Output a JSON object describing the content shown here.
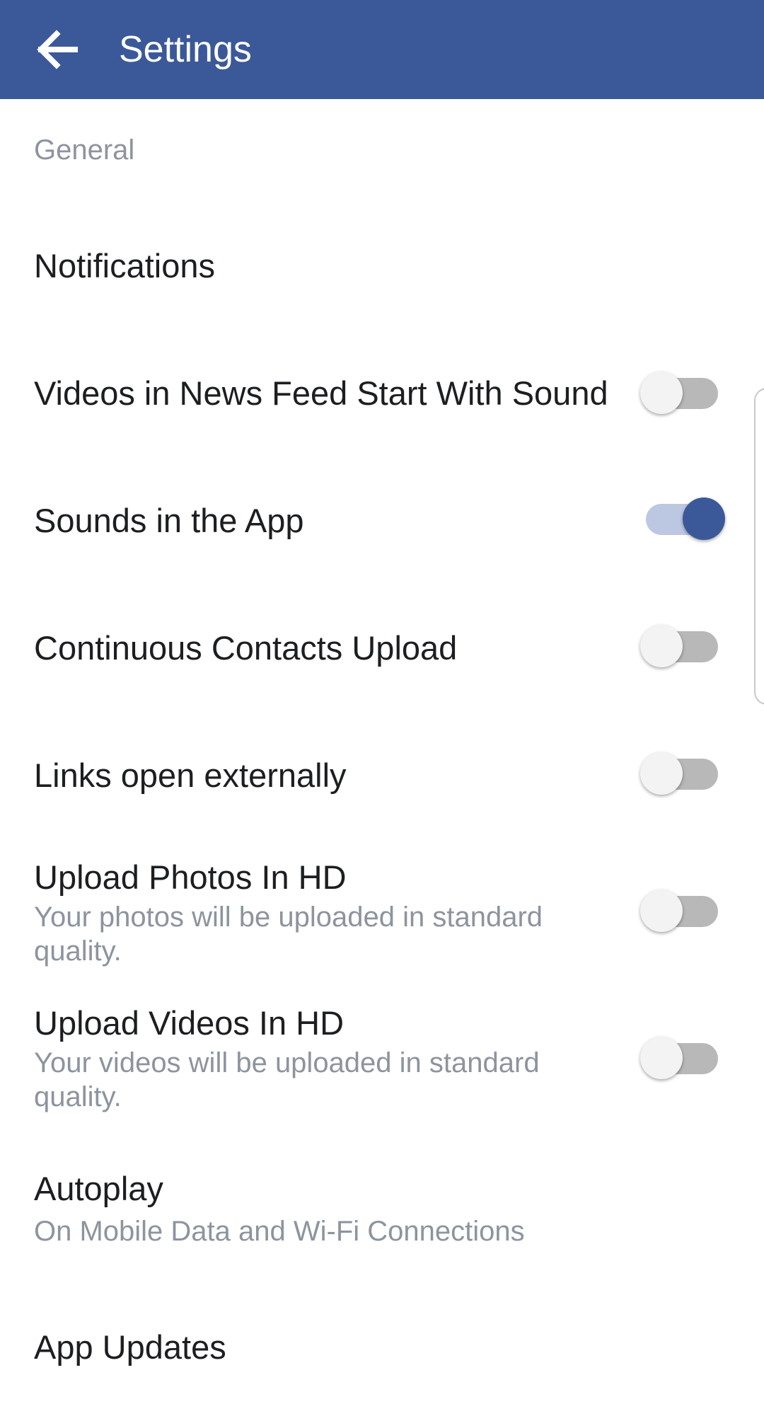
{
  "app_bar": {
    "title": "Settings",
    "back_icon": "arrow-back-icon",
    "background": "#3b5998"
  },
  "section_header": "General",
  "items": [
    {
      "label": "Notifications",
      "subtitle": "",
      "toggle": null
    },
    {
      "label": "Videos in News Feed Start With Sound",
      "subtitle": "",
      "toggle": false
    },
    {
      "label": "Sounds in the App",
      "subtitle": "",
      "toggle": true
    },
    {
      "label": "Continuous Contacts Upload",
      "subtitle": "",
      "toggle": false
    },
    {
      "label": "Links open externally",
      "subtitle": "",
      "toggle": false
    },
    {
      "label": "Upload Photos In HD",
      "subtitle": "Your photos will be uploaded in standard quality.",
      "toggle": false
    },
    {
      "label": "Upload Videos In HD",
      "subtitle": "Your videos will be uploaded in standard quality.",
      "toggle": false
    },
    {
      "label": "Autoplay",
      "subtitle": "On Mobile Data and Wi-Fi Connections",
      "toggle": null
    },
    {
      "label": "App Updates",
      "subtitle": "",
      "toggle": null
    }
  ],
  "colors": {
    "accent": "#3b5998",
    "text_primary": "#1c1e21",
    "text_secondary": "#8d949e"
  }
}
